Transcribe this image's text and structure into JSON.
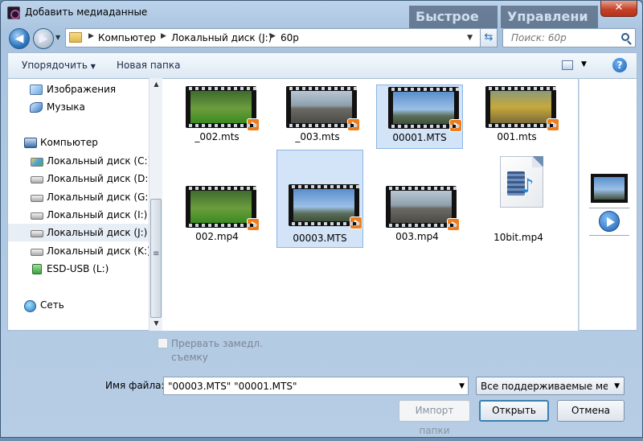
{
  "window": {
    "title": "Добавить медиаданные",
    "close_label": "✕"
  },
  "background_tabs": [
    {
      "label": "Быстрое"
    },
    {
      "label": "Управлени"
    }
  ],
  "address": {
    "crumbs": [
      "Компьютер",
      "Локальный диск (J:)",
      "60p"
    ]
  },
  "search": {
    "placeholder": "Поиск: 60р"
  },
  "toolbar": {
    "organize_label": "Упорядочить",
    "new_folder_label": "Новая папка"
  },
  "sidebar": {
    "items": [
      {
        "label": "Изображения",
        "icon": "images-icon"
      },
      {
        "label": "Музыка",
        "icon": "music-icon"
      },
      {
        "label": "Компьютер",
        "icon": "computer-icon"
      },
      {
        "label": "Локальный диск (C:)",
        "icon": "disk-c-icon"
      },
      {
        "label": "Локальный диск (D:)",
        "icon": "disk-icon"
      },
      {
        "label": "Локальный диск (G:)",
        "icon": "disk-icon"
      },
      {
        "label": "Локальный диск (I:)",
        "icon": "disk-icon"
      },
      {
        "label": "Локальный диск (J:)",
        "icon": "disk-icon",
        "selected": true
      },
      {
        "label": "Локальный диск (K:)",
        "icon": "disk-icon"
      },
      {
        "label": "ESD-USB (L:)",
        "icon": "usb-icon"
      },
      {
        "label": "Сеть",
        "icon": "network-icon"
      }
    ]
  },
  "files": [
    {
      "name": "_002.mts",
      "thumb": "deer",
      "selected": false
    },
    {
      "name": "_003.mts",
      "thumb": "road",
      "selected": false
    },
    {
      "name": "00001.MTS",
      "thumb": "tower",
      "selected": true
    },
    {
      "name": "001.mts",
      "thumb": "car",
      "selected": false
    },
    {
      "name": "002.mp4",
      "thumb": "deer",
      "selected": false
    },
    {
      "name": "00003.MTS",
      "thumb": "tower",
      "selected": true
    },
    {
      "name": "003.mp4",
      "thumb": "road",
      "selected": false
    },
    {
      "name": "10bit.mp4",
      "thumb": "media-file-icon",
      "selected": false
    }
  ],
  "options": {
    "interrupt_slowmo_label_line1": "Прервать замедл.",
    "interrupt_slowmo_label_line2": "съемку"
  },
  "filename": {
    "label": "Имя файла:",
    "value": "\"00003.MTS\" \"00001.MTS\""
  },
  "filter": {
    "value": "Все поддерживаемые меди"
  },
  "buttons": {
    "import_folder": "Импорт папки",
    "open": "Открыть",
    "cancel": "Отмена"
  }
}
